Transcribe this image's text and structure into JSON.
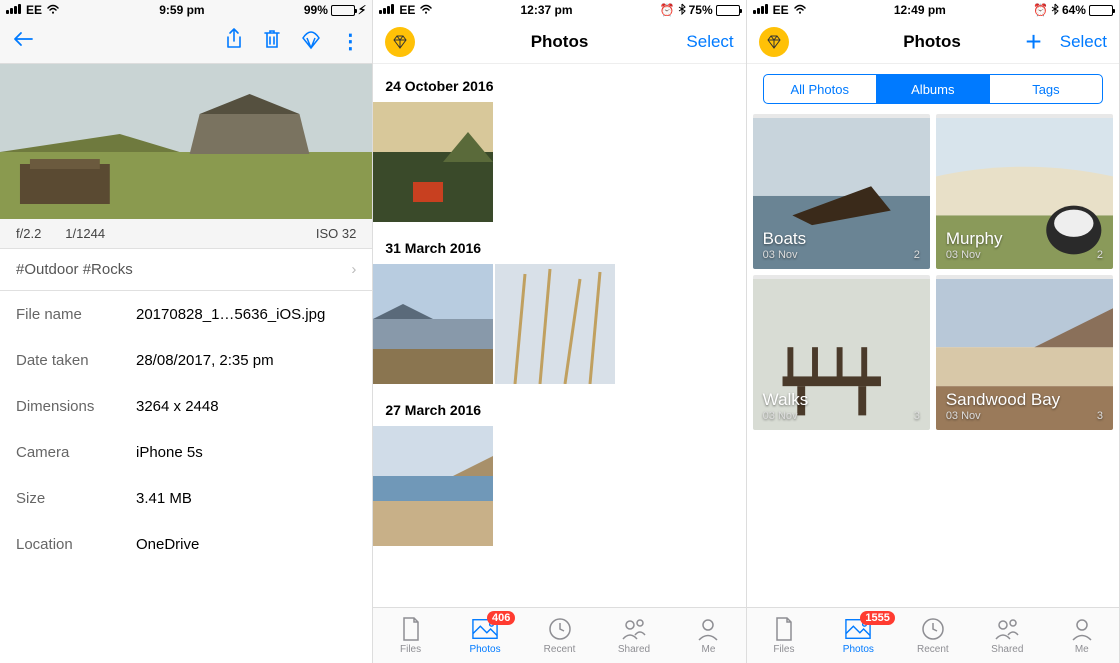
{
  "screen1": {
    "status": {
      "carrier": "EE",
      "time": "9:59 pm",
      "battery_pct": "99%"
    },
    "meta": {
      "aperture": "f/2.2",
      "shutter": "1/1244",
      "iso": "ISO 32"
    },
    "tags": "#Outdoor #Rocks",
    "rows": {
      "filename_label": "File name",
      "filename": "20170828_1…5636_iOS.jpg",
      "datetaken_label": "Date taken",
      "datetaken": "28/08/2017, 2:35 pm",
      "dimensions_label": "Dimensions",
      "dimensions": "3264 x 2448",
      "camera_label": "Camera",
      "camera": "iPhone 5s",
      "size_label": "Size",
      "size": "3.41 MB",
      "location_label": "Location",
      "location": "OneDrive"
    }
  },
  "screen2": {
    "status": {
      "carrier": "EE",
      "time": "12:37 pm",
      "battery_pct": "75%"
    },
    "title": "Photos",
    "select": "Select",
    "sections": {
      "d1": "24 October 2016",
      "d2": "31 March 2016",
      "d3": "27 March 2016"
    },
    "tabs": {
      "files": "Files",
      "photos": "Photos",
      "recent": "Recent",
      "shared": "Shared",
      "me": "Me",
      "badge": "406"
    }
  },
  "screen3": {
    "status": {
      "carrier": "EE",
      "time": "12:49 pm",
      "battery_pct": "64%"
    },
    "title": "Photos",
    "select": "Select",
    "segments": {
      "all": "All Photos",
      "albums": "Albums",
      "tags": "Tags"
    },
    "albums": {
      "a1_name": "Boats",
      "a1_date": "03 Nov",
      "a1_count": "2",
      "a2_name": "Murphy",
      "a2_date": "03 Nov",
      "a2_count": "2",
      "a3_name": "Walks",
      "a3_date": "03 Nov",
      "a3_count": "3",
      "a4_name": "Sandwood Bay",
      "a4_date": "03 Nov",
      "a4_count": "3"
    },
    "tabs": {
      "files": "Files",
      "photos": "Photos",
      "recent": "Recent",
      "shared": "Shared",
      "me": "Me",
      "badge": "1555"
    }
  }
}
